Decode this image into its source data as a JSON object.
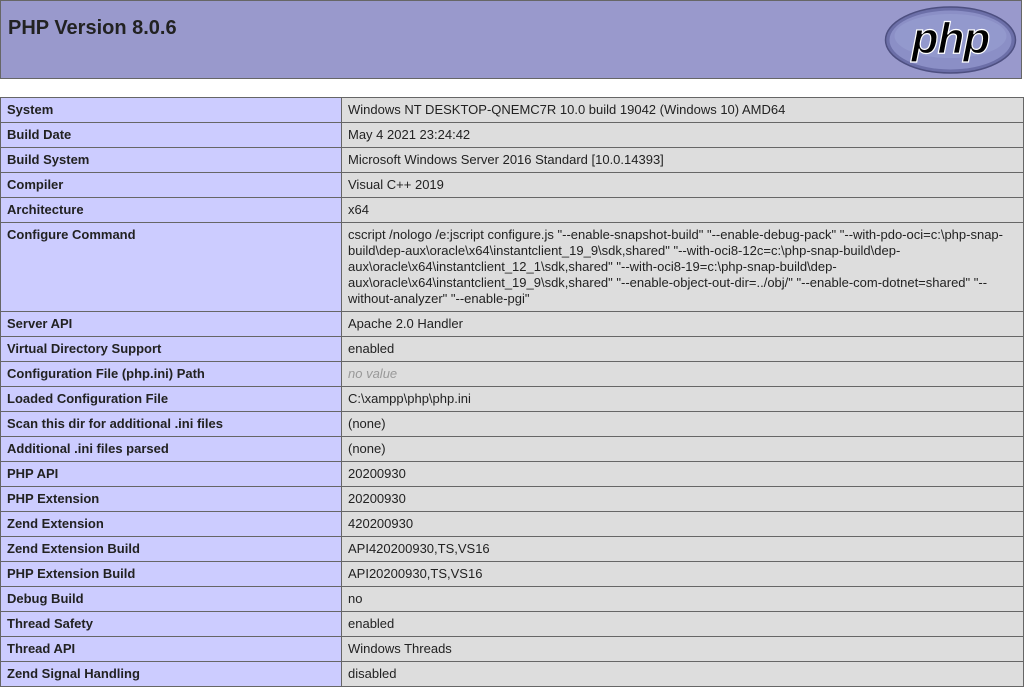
{
  "header": {
    "title": "PHP Version 8.0.6",
    "logo_text": "php",
    "bg_color": "#9999cc"
  },
  "rows": [
    {
      "key": "System",
      "value": "Windows NT DESKTOP-QNEMC7R 10.0 build 19042 (Windows 10) AMD64"
    },
    {
      "key": "Build Date",
      "value": "May 4 2021 23:24:42"
    },
    {
      "key": "Build System",
      "value": "Microsoft Windows Server 2016 Standard [10.0.14393]"
    },
    {
      "key": "Compiler",
      "value": "Visual C++ 2019"
    },
    {
      "key": "Architecture",
      "value": "x64"
    },
    {
      "key": "Configure Command",
      "value": "cscript /nologo /e:jscript configure.js \"--enable-snapshot-build\" \"--enable-debug-pack\" \"--with-pdo-oci=c:\\php-snap-build\\dep-aux\\oracle\\x64\\instantclient_19_9\\sdk,shared\" \"--with-oci8-12c=c:\\php-snap-build\\dep-aux\\oracle\\x64\\instantclient_12_1\\sdk,shared\" \"--with-oci8-19=c:\\php-snap-build\\dep-aux\\oracle\\x64\\instantclient_19_9\\sdk,shared\" \"--enable-object-out-dir=../obj/\" \"--enable-com-dotnet=shared\" \"--without-analyzer\" \"--enable-pgi\""
    },
    {
      "key": "Server API",
      "value": "Apache 2.0 Handler"
    },
    {
      "key": "Virtual Directory Support",
      "value": "enabled"
    },
    {
      "key": "Configuration File (php.ini) Path",
      "value": "no value",
      "novalue": true
    },
    {
      "key": "Loaded Configuration File",
      "value": "C:\\xampp\\php\\php.ini"
    },
    {
      "key": "Scan this dir for additional .ini files",
      "value": "(none)"
    },
    {
      "key": "Additional .ini files parsed",
      "value": "(none)"
    },
    {
      "key": "PHP API",
      "value": "20200930"
    },
    {
      "key": "PHP Extension",
      "value": "20200930"
    },
    {
      "key": "Zend Extension",
      "value": "420200930"
    },
    {
      "key": "Zend Extension Build",
      "value": "API420200930,TS,VS16"
    },
    {
      "key": "PHP Extension Build",
      "value": "API20200930,TS,VS16"
    },
    {
      "key": "Debug Build",
      "value": "no"
    },
    {
      "key": "Thread Safety",
      "value": "enabled"
    },
    {
      "key": "Thread API",
      "value": "Windows Threads"
    },
    {
      "key": "Zend Signal Handling",
      "value": "disabled"
    }
  ]
}
